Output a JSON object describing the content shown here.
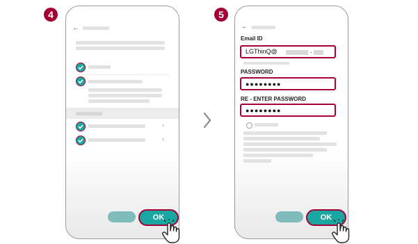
{
  "steps": {
    "left": {
      "number": "4"
    },
    "right": {
      "number": "5"
    }
  },
  "left_screen": {
    "ok_button": "OK"
  },
  "right_screen": {
    "email_label": "Email ID",
    "email_value": "LGThinQ@",
    "email_dot": ".",
    "password_label": "PASSWORD",
    "password_value": "●●●●●●●●",
    "reenter_label": "RE - ENTER PASSWORD",
    "reenter_value": "●●●●●●●●",
    "ok_button": "OK"
  },
  "icons": {
    "back": "back-arrow-icon",
    "check": "check-circle-icon",
    "chevron": "chevron-right-icon",
    "hand": "tap-hand-icon",
    "between": "chevron-right-icon"
  },
  "colors": {
    "brand": "#a50034",
    "accent": "#1aa6a1",
    "disabled": "#80bcbb"
  }
}
